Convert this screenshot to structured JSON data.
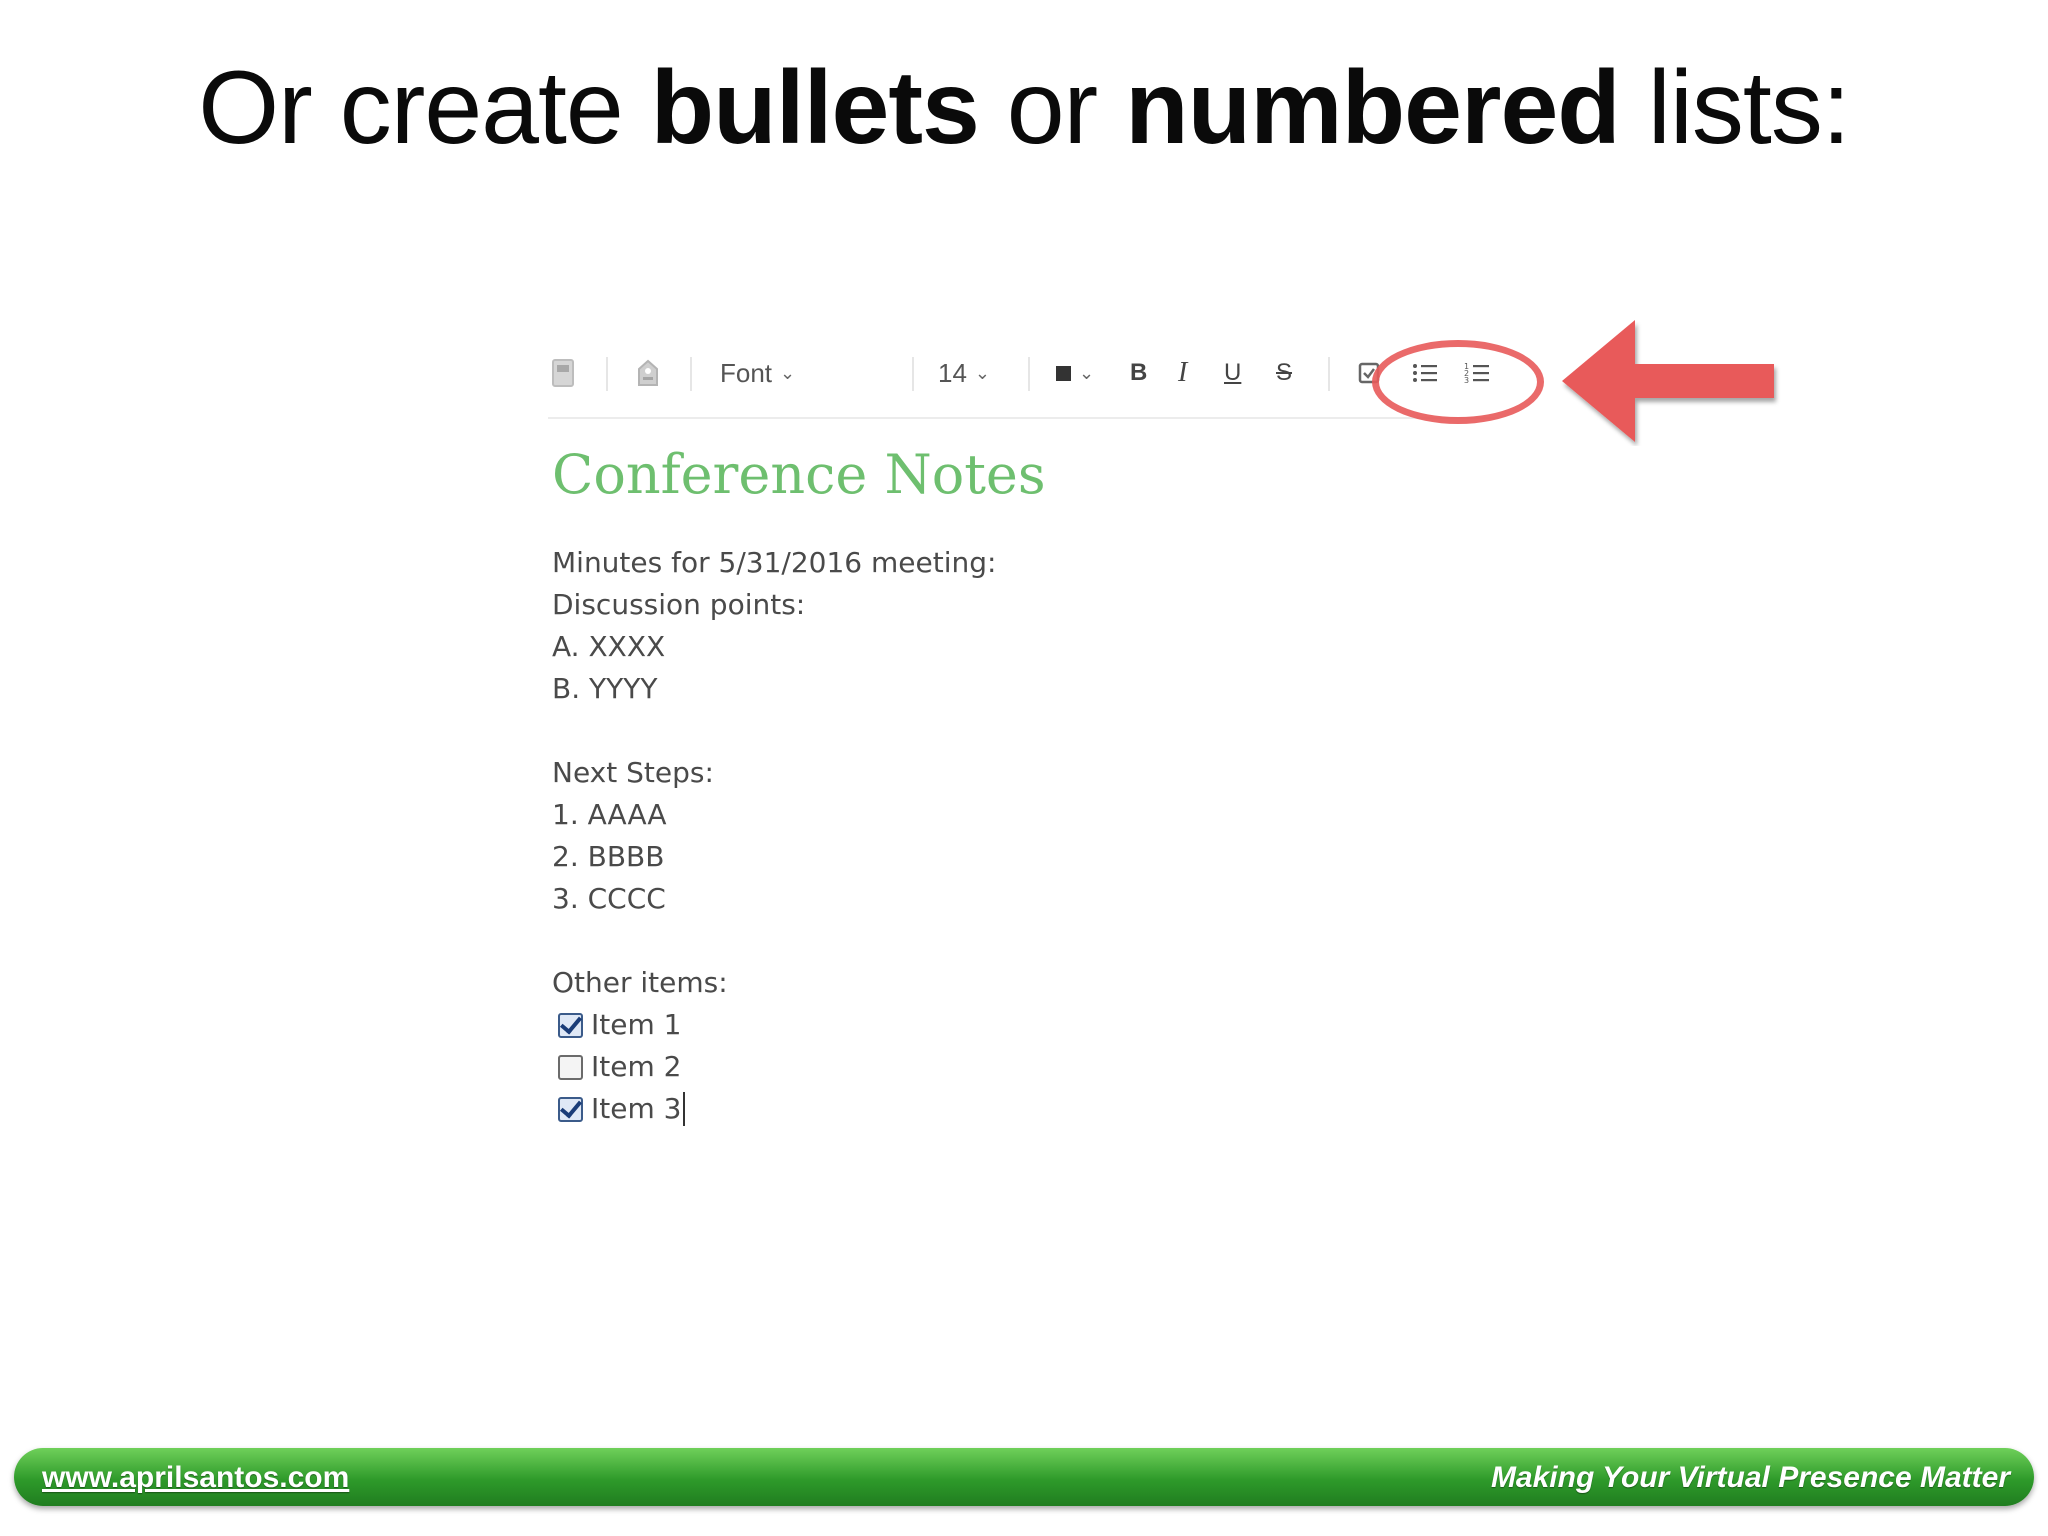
{
  "slide": {
    "title_parts": [
      "Or create ",
      "bullets",
      " or ",
      "numbered",
      " lists:"
    ]
  },
  "toolbar": {
    "font_label": "Font",
    "size_label": "14",
    "bold_label": "B",
    "italic_label": "I",
    "underline_label": "U",
    "strike_label": "S",
    "icons": [
      "note-icon",
      "tag-icon",
      "color-swatch-icon",
      "checkbox-icon",
      "bulleted-list-icon",
      "numbered-list-icon"
    ]
  },
  "note": {
    "title": "Conference Notes",
    "lines": [
      "Minutes for 5/31/2016 meeting:",
      "Discussion points:",
      "A. XXXX",
      "B. YYYY",
      "",
      "Next Steps:",
      "1. AAAA",
      "2. BBBB",
      "3. CCCC",
      "",
      "Other items:"
    ],
    "checklist": [
      {
        "label": "Item 1",
        "checked": true
      },
      {
        "label": "Item 2",
        "checked": false
      },
      {
        "label": "Item 3",
        "checked": true
      }
    ]
  },
  "footer": {
    "website": "www.aprilsantos.com",
    "tagline": "Making Your Virtual Presence Matter"
  },
  "colors": {
    "accent_green": "#6ebf6f",
    "highlight_red": "#e85a5a",
    "footer_green": "#2e9a2a"
  }
}
